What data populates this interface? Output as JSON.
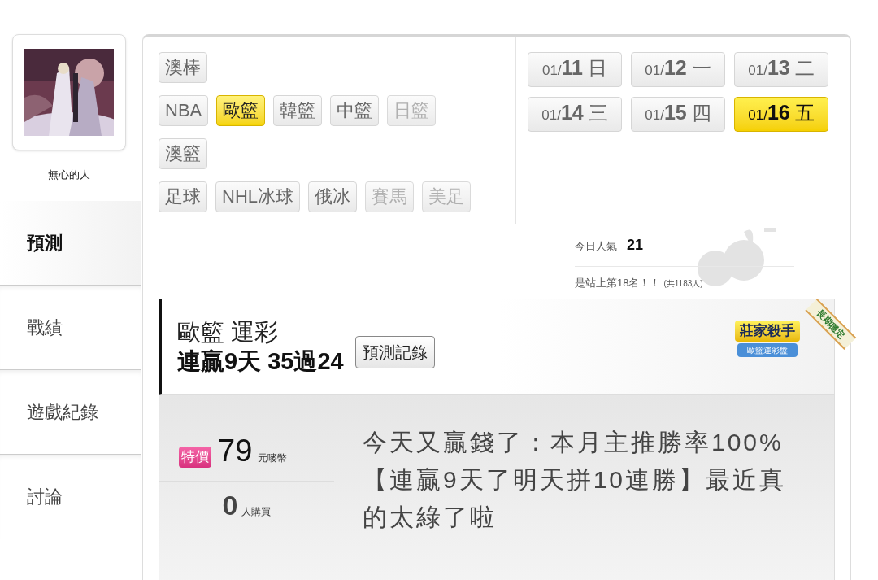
{
  "profile": {
    "kind": "picture",
    "name": "無心的人"
  },
  "sidebar": {
    "items": [
      {
        "label": "預測",
        "selected": true
      },
      {
        "label": "戰績",
        "selected": false
      },
      {
        "label": "遊戲紀錄",
        "selected": false
      },
      {
        "label": "討論",
        "selected": false
      }
    ]
  },
  "sports": [
    [
      {
        "label": "澳棒",
        "selected": false,
        "disabled": false
      }
    ],
    [
      {
        "label": "NBA",
        "selected": false,
        "disabled": false
      },
      {
        "label": "歐籃",
        "selected": true,
        "disabled": false
      },
      {
        "label": "韓籃",
        "selected": false,
        "disabled": false
      },
      {
        "label": "中籃",
        "selected": false,
        "disabled": false
      },
      {
        "label": "日籃",
        "selected": false,
        "disabled": true
      }
    ],
    [
      {
        "label": "澳籃",
        "selected": false,
        "disabled": false
      }
    ],
    [
      {
        "label": "足球",
        "selected": false,
        "disabled": false
      },
      {
        "label": "NHL冰球",
        "selected": false,
        "disabled": false
      },
      {
        "label": "俄冰",
        "selected": false,
        "disabled": false
      },
      {
        "label": "賽馬",
        "selected": false,
        "disabled": true
      },
      {
        "label": "美足",
        "selected": false,
        "disabled": true
      }
    ]
  ],
  "dates": [
    {
      "month": "01/",
      "day": "11",
      "weekday": "日",
      "selected": false
    },
    {
      "month": "01/",
      "day": "12",
      "weekday": "一",
      "selected": false
    },
    {
      "month": "01/",
      "day": "13",
      "weekday": "二",
      "selected": false
    },
    {
      "month": "01/",
      "day": "14",
      "weekday": "三",
      "selected": false
    },
    {
      "month": "01/",
      "day": "15",
      "weekday": "四",
      "selected": false
    },
    {
      "month": "01/",
      "day": "16",
      "weekday": "五",
      "selected": true
    }
  ],
  "popularity": {
    "label": "今日人氣",
    "value": "21",
    "rank": "是站上第18名！！",
    "total": "(共1183人)"
  },
  "header": {
    "title": "歐籃 運彩",
    "streak": "連贏9天 35過24",
    "record_button": "預測記錄",
    "badge": {
      "title": "莊家殺手",
      "subtitle": "歐籃運彩盤",
      "ribbon": "長期穩定"
    }
  },
  "offer": {
    "tag": "特價",
    "price": "79",
    "unit": "元嘜幣",
    "buyers": "0",
    "buyers_unit": "人購買",
    "text": "今天又贏錢了：本月主推勝率100%【連贏9天了明天拼10連勝】最近真的太綠了啦"
  }
}
